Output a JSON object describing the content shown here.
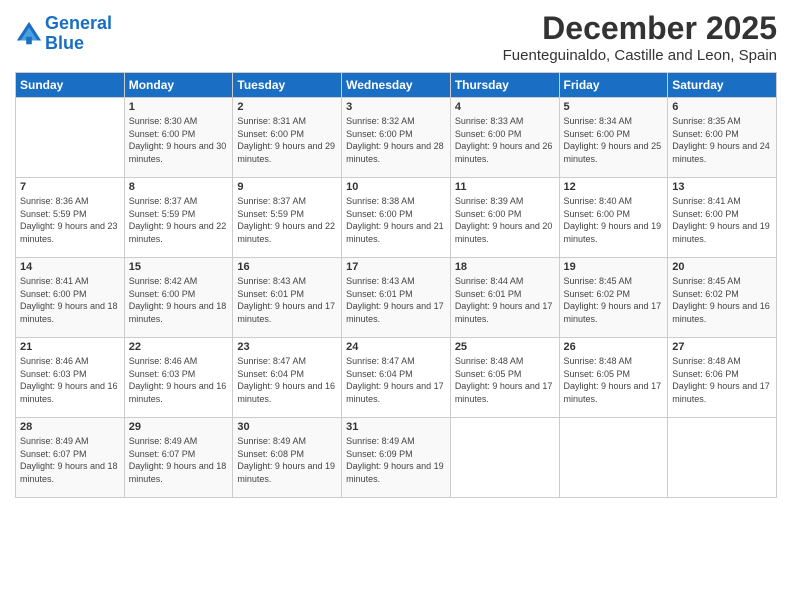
{
  "logo": {
    "line1": "General",
    "line2": "Blue"
  },
  "title": "December 2025",
  "subtitle": "Fuenteguinaldo, Castille and Leon, Spain",
  "weekdays": [
    "Sunday",
    "Monday",
    "Tuesday",
    "Wednesday",
    "Thursday",
    "Friday",
    "Saturday"
  ],
  "weeks": [
    [
      {
        "day": "",
        "sunrise": "",
        "sunset": "",
        "daylight": ""
      },
      {
        "day": "1",
        "sunrise": "Sunrise: 8:30 AM",
        "sunset": "Sunset: 6:00 PM",
        "daylight": "Daylight: 9 hours and 30 minutes."
      },
      {
        "day": "2",
        "sunrise": "Sunrise: 8:31 AM",
        "sunset": "Sunset: 6:00 PM",
        "daylight": "Daylight: 9 hours and 29 minutes."
      },
      {
        "day": "3",
        "sunrise": "Sunrise: 8:32 AM",
        "sunset": "Sunset: 6:00 PM",
        "daylight": "Daylight: 9 hours and 28 minutes."
      },
      {
        "day": "4",
        "sunrise": "Sunrise: 8:33 AM",
        "sunset": "Sunset: 6:00 PM",
        "daylight": "Daylight: 9 hours and 26 minutes."
      },
      {
        "day": "5",
        "sunrise": "Sunrise: 8:34 AM",
        "sunset": "Sunset: 6:00 PM",
        "daylight": "Daylight: 9 hours and 25 minutes."
      },
      {
        "day": "6",
        "sunrise": "Sunrise: 8:35 AM",
        "sunset": "Sunset: 6:00 PM",
        "daylight": "Daylight: 9 hours and 24 minutes."
      }
    ],
    [
      {
        "day": "7",
        "sunrise": "Sunrise: 8:36 AM",
        "sunset": "Sunset: 5:59 PM",
        "daylight": "Daylight: 9 hours and 23 minutes."
      },
      {
        "day": "8",
        "sunrise": "Sunrise: 8:37 AM",
        "sunset": "Sunset: 5:59 PM",
        "daylight": "Daylight: 9 hours and 22 minutes."
      },
      {
        "day": "9",
        "sunrise": "Sunrise: 8:37 AM",
        "sunset": "Sunset: 5:59 PM",
        "daylight": "Daylight: 9 hours and 22 minutes."
      },
      {
        "day": "10",
        "sunrise": "Sunrise: 8:38 AM",
        "sunset": "Sunset: 6:00 PM",
        "daylight": "Daylight: 9 hours and 21 minutes."
      },
      {
        "day": "11",
        "sunrise": "Sunrise: 8:39 AM",
        "sunset": "Sunset: 6:00 PM",
        "daylight": "Daylight: 9 hours and 20 minutes."
      },
      {
        "day": "12",
        "sunrise": "Sunrise: 8:40 AM",
        "sunset": "Sunset: 6:00 PM",
        "daylight": "Daylight: 9 hours and 19 minutes."
      },
      {
        "day": "13",
        "sunrise": "Sunrise: 8:41 AM",
        "sunset": "Sunset: 6:00 PM",
        "daylight": "Daylight: 9 hours and 19 minutes."
      }
    ],
    [
      {
        "day": "14",
        "sunrise": "Sunrise: 8:41 AM",
        "sunset": "Sunset: 6:00 PM",
        "daylight": "Daylight: 9 hours and 18 minutes."
      },
      {
        "day": "15",
        "sunrise": "Sunrise: 8:42 AM",
        "sunset": "Sunset: 6:00 PM",
        "daylight": "Daylight: 9 hours and 18 minutes."
      },
      {
        "day": "16",
        "sunrise": "Sunrise: 8:43 AM",
        "sunset": "Sunset: 6:01 PM",
        "daylight": "Daylight: 9 hours and 17 minutes."
      },
      {
        "day": "17",
        "sunrise": "Sunrise: 8:43 AM",
        "sunset": "Sunset: 6:01 PM",
        "daylight": "Daylight: 9 hours and 17 minutes."
      },
      {
        "day": "18",
        "sunrise": "Sunrise: 8:44 AM",
        "sunset": "Sunset: 6:01 PM",
        "daylight": "Daylight: 9 hours and 17 minutes."
      },
      {
        "day": "19",
        "sunrise": "Sunrise: 8:45 AM",
        "sunset": "Sunset: 6:02 PM",
        "daylight": "Daylight: 9 hours and 17 minutes."
      },
      {
        "day": "20",
        "sunrise": "Sunrise: 8:45 AM",
        "sunset": "Sunset: 6:02 PM",
        "daylight": "Daylight: 9 hours and 16 minutes."
      }
    ],
    [
      {
        "day": "21",
        "sunrise": "Sunrise: 8:46 AM",
        "sunset": "Sunset: 6:03 PM",
        "daylight": "Daylight: 9 hours and 16 minutes."
      },
      {
        "day": "22",
        "sunrise": "Sunrise: 8:46 AM",
        "sunset": "Sunset: 6:03 PM",
        "daylight": "Daylight: 9 hours and 16 minutes."
      },
      {
        "day": "23",
        "sunrise": "Sunrise: 8:47 AM",
        "sunset": "Sunset: 6:04 PM",
        "daylight": "Daylight: 9 hours and 16 minutes."
      },
      {
        "day": "24",
        "sunrise": "Sunrise: 8:47 AM",
        "sunset": "Sunset: 6:04 PM",
        "daylight": "Daylight: 9 hours and 17 minutes."
      },
      {
        "day": "25",
        "sunrise": "Sunrise: 8:48 AM",
        "sunset": "Sunset: 6:05 PM",
        "daylight": "Daylight: 9 hours and 17 minutes."
      },
      {
        "day": "26",
        "sunrise": "Sunrise: 8:48 AM",
        "sunset": "Sunset: 6:05 PM",
        "daylight": "Daylight: 9 hours and 17 minutes."
      },
      {
        "day": "27",
        "sunrise": "Sunrise: 8:48 AM",
        "sunset": "Sunset: 6:06 PM",
        "daylight": "Daylight: 9 hours and 17 minutes."
      }
    ],
    [
      {
        "day": "28",
        "sunrise": "Sunrise: 8:49 AM",
        "sunset": "Sunset: 6:07 PM",
        "daylight": "Daylight: 9 hours and 18 minutes."
      },
      {
        "day": "29",
        "sunrise": "Sunrise: 8:49 AM",
        "sunset": "Sunset: 6:07 PM",
        "daylight": "Daylight: 9 hours and 18 minutes."
      },
      {
        "day": "30",
        "sunrise": "Sunrise: 8:49 AM",
        "sunset": "Sunset: 6:08 PM",
        "daylight": "Daylight: 9 hours and 19 minutes."
      },
      {
        "day": "31",
        "sunrise": "Sunrise: 8:49 AM",
        "sunset": "Sunset: 6:09 PM",
        "daylight": "Daylight: 9 hours and 19 minutes."
      },
      {
        "day": "",
        "sunrise": "",
        "sunset": "",
        "daylight": ""
      },
      {
        "day": "",
        "sunrise": "",
        "sunset": "",
        "daylight": ""
      },
      {
        "day": "",
        "sunrise": "",
        "sunset": "",
        "daylight": ""
      }
    ]
  ]
}
